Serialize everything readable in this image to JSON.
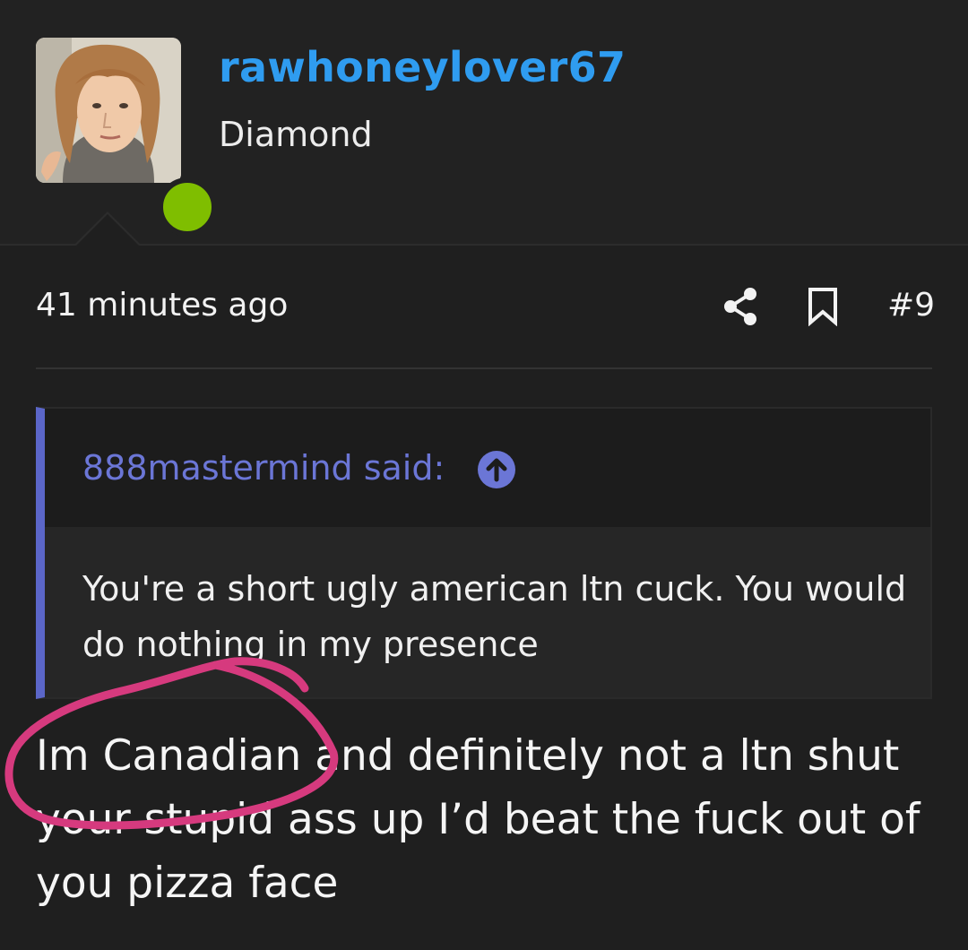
{
  "post": {
    "author": {
      "username": "rawhoneylover67",
      "rank": "Diamond",
      "online": true
    },
    "timestamp": "41 minutes ago",
    "post_number": "#9",
    "actions": {
      "share_icon": "share-icon",
      "bookmark_icon": "bookmark-icon"
    },
    "quote": {
      "author_line": "888mastermind said:",
      "arrow_icon": "arrow-up-circle-icon",
      "text": "You're a short ugly american ltn cuck. You would do nothing in my presence"
    },
    "reply": "Im Canadian and definitely not a ltn shut your stupid ass up I’d beat the fuck out of you pizza face"
  },
  "colors": {
    "background": "#1f1f1f",
    "username": "#2f9cf0",
    "quote_accent": "#5b66c8",
    "online": "#7fbe00",
    "annotation": "#d63a7e"
  }
}
